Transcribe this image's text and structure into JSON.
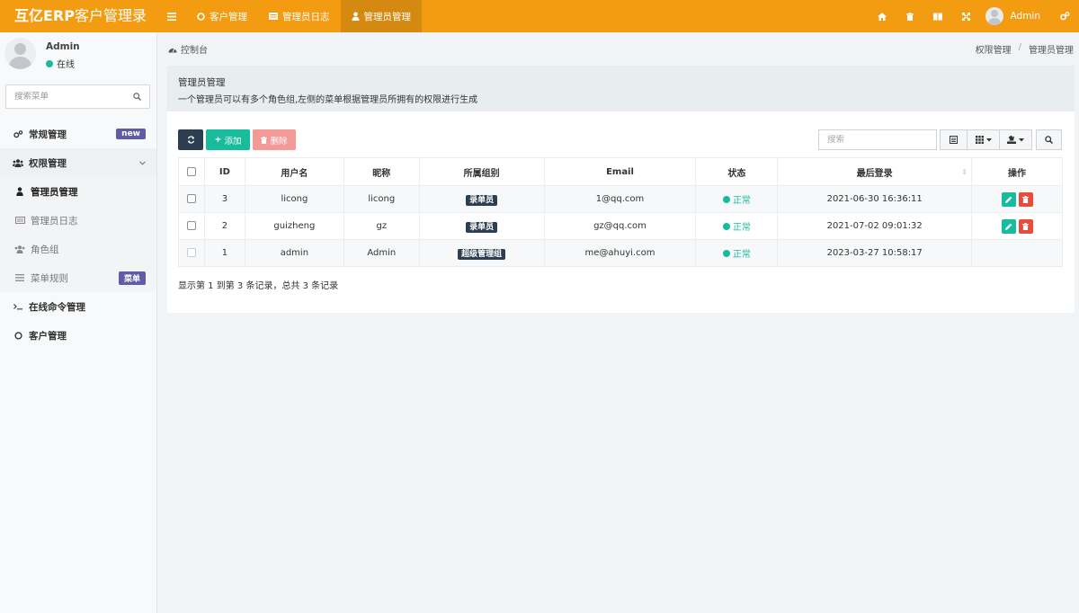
{
  "app": {
    "logo_bold": "互亿ERP",
    "logo_rest": "客户管理录"
  },
  "topnav": {
    "tabs": [
      {
        "label": "客户管理",
        "icon": "circle-icon"
      },
      {
        "label": "管理员日志",
        "icon": "list-icon"
      },
      {
        "label": "管理员管理",
        "icon": "user-icon",
        "active": true
      }
    ],
    "user": "Admin"
  },
  "sidebar": {
    "username": "Admin",
    "status": "在线",
    "search_placeholder": "搜索菜单",
    "items": [
      {
        "label": "常规管理",
        "badge": "new"
      },
      {
        "label": "权限管理"
      },
      {
        "label": "管理员管理"
      },
      {
        "label": "管理员日志"
      },
      {
        "label": "角色组"
      },
      {
        "label": "菜单规则",
        "badge": "菜单"
      },
      {
        "label": "在线命令管理"
      },
      {
        "label": "客户管理"
      }
    ]
  },
  "breadcrumb": {
    "left": "控制台",
    "right": [
      "权限管理",
      "管理员管理"
    ]
  },
  "panel": {
    "title": "管理员管理",
    "description": "一个管理员可以有多个角色组,左侧的菜单根据管理员所拥有的权限进行生成"
  },
  "toolbar": {
    "add_label": "添加",
    "delete_label": "删除",
    "search_placeholder": "搜索"
  },
  "table": {
    "headers": [
      "ID",
      "用户名",
      "昵称",
      "所属组别",
      "Email",
      "状态",
      "最后登录",
      "操作"
    ],
    "rows": [
      {
        "id": "3",
        "username": "licong",
        "nickname": "licong",
        "group": "录单员",
        "email": "1@qq.com",
        "status": "正常",
        "last_login": "2021-06-30 16:36:11"
      },
      {
        "id": "2",
        "username": "guizheng",
        "nickname": "gz",
        "group": "录单员",
        "email": "gz@qq.com",
        "status": "正常",
        "last_login": "2021-07-02 09:01:32"
      },
      {
        "id": "1",
        "username": "admin",
        "nickname": "Admin",
        "group": "超级管理组",
        "email": "me@ahuyi.com",
        "status": "正常",
        "last_login": "2023-03-27 10:58:17"
      }
    ],
    "summary": "显示第 1 到第 3 条记录，总共 3 条记录"
  },
  "colors": {
    "topbar": "#f39c12",
    "success": "#18bc9c",
    "danger": "#e74c3c",
    "dark": "#2c3e50",
    "badge": "#605ca8"
  }
}
